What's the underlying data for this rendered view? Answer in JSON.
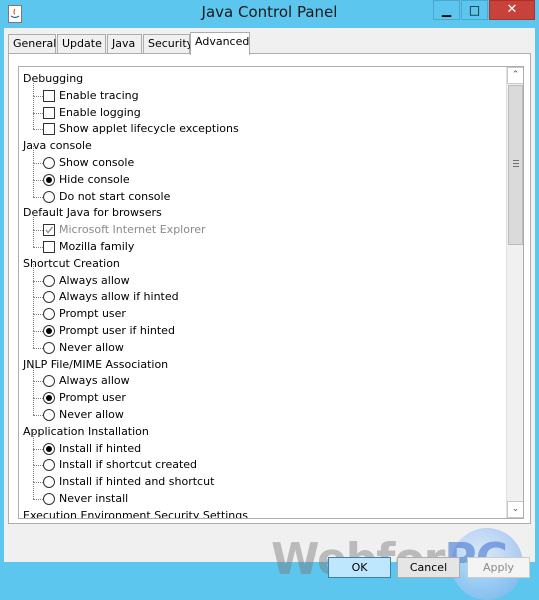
{
  "window": {
    "title": "Java Control Panel",
    "minimize_glyph": "▁",
    "maximize_glyph": "□",
    "close_glyph": "✕"
  },
  "tabs": [
    {
      "label": "General"
    },
    {
      "label": "Update"
    },
    {
      "label": "Java"
    },
    {
      "label": "Security"
    },
    {
      "label": "Advanced",
      "active": true
    }
  ],
  "sections": [
    {
      "title": "Debugging",
      "options": [
        {
          "label": "Enable tracing",
          "type": "checkbox",
          "checked": false
        },
        {
          "label": "Enable logging",
          "type": "checkbox",
          "checked": false
        },
        {
          "label": "Show applet lifecycle exceptions",
          "type": "checkbox",
          "checked": false
        }
      ]
    },
    {
      "title": "Java console",
      "options": [
        {
          "label": "Show console",
          "type": "radio",
          "checked": false
        },
        {
          "label": "Hide console",
          "type": "radio",
          "checked": true
        },
        {
          "label": "Do not start console",
          "type": "radio",
          "checked": false
        }
      ]
    },
    {
      "title": "Default Java for browsers",
      "options": [
        {
          "label": "Microsoft Internet Explorer",
          "type": "checkbox",
          "checked": true,
          "disabled": true
        },
        {
          "label": "Mozilla family",
          "type": "checkbox",
          "checked": false
        }
      ]
    },
    {
      "title": "Shortcut Creation",
      "options": [
        {
          "label": "Always allow",
          "type": "radio",
          "checked": false
        },
        {
          "label": "Always allow if hinted",
          "type": "radio",
          "checked": false
        },
        {
          "label": "Prompt user",
          "type": "radio",
          "checked": false
        },
        {
          "label": "Prompt user if hinted",
          "type": "radio",
          "checked": true
        },
        {
          "label": "Never allow",
          "type": "radio",
          "checked": false
        }
      ]
    },
    {
      "title": "JNLP File/MIME Association",
      "options": [
        {
          "label": "Always allow",
          "type": "radio",
          "checked": false
        },
        {
          "label": "Prompt user",
          "type": "radio",
          "checked": true
        },
        {
          "label": "Never allow",
          "type": "radio",
          "checked": false
        }
      ]
    },
    {
      "title": "Application Installation",
      "options": [
        {
          "label": "Install if hinted",
          "type": "radio",
          "checked": true
        },
        {
          "label": "Install if shortcut created",
          "type": "radio",
          "checked": false
        },
        {
          "label": "Install if hinted and shortcut",
          "type": "radio",
          "checked": false
        },
        {
          "label": "Never install",
          "type": "radio",
          "checked": false
        }
      ]
    },
    {
      "title": "Execution Environment Security Settings",
      "options": []
    }
  ],
  "scrollbar": {
    "up_glyph": "⌃",
    "down_glyph": "⌄"
  },
  "watermark": {
    "text": "Webfor",
    "accent": "PC"
  },
  "buttons": {
    "ok": "OK",
    "cancel": "Cancel",
    "apply": "Apply",
    "apply_enabled": false
  },
  "colors": {
    "titlebar": "#5dc6ee",
    "close_button": "#c7423a",
    "ok_button": "#bee6fd",
    "ok_border": "#3c7fb1"
  }
}
